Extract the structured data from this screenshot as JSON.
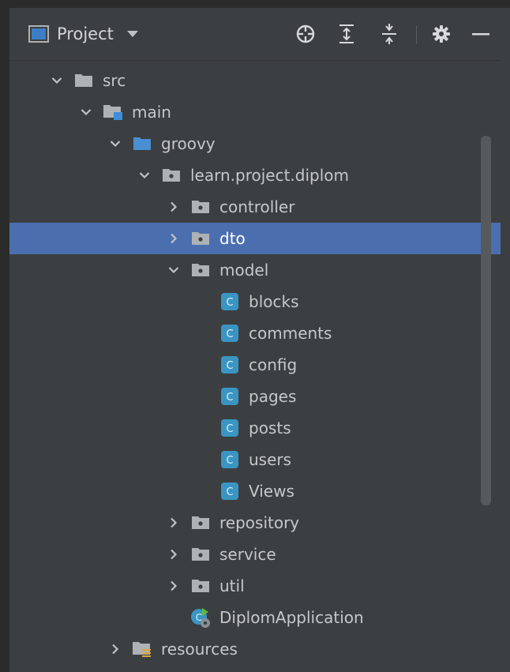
{
  "toolbar": {
    "title": "Project",
    "icons": [
      "project-window-icon",
      "chevron-down-icon",
      "locate-icon",
      "expand-all-icon",
      "collapse-all-icon",
      "gear-icon",
      "minimize-icon"
    ]
  },
  "tree": {
    "items": [
      {
        "label": "src",
        "depth": 0,
        "expanded": true,
        "kind": "folder-plain"
      },
      {
        "label": "main",
        "depth": 1,
        "expanded": true,
        "kind": "folder-module"
      },
      {
        "label": "groovy",
        "depth": 2,
        "expanded": true,
        "kind": "folder-source"
      },
      {
        "label": "learn.project.diplom",
        "depth": 3,
        "expanded": true,
        "kind": "package"
      },
      {
        "label": "controller",
        "depth": 4,
        "expanded": false,
        "kind": "package"
      },
      {
        "label": "dto",
        "depth": 4,
        "expanded": false,
        "kind": "package",
        "selected": true
      },
      {
        "label": "model",
        "depth": 4,
        "expanded": true,
        "kind": "package"
      },
      {
        "label": "blocks",
        "depth": 5,
        "kind": "class",
        "glyph": "C"
      },
      {
        "label": "comments",
        "depth": 5,
        "kind": "class",
        "glyph": "C"
      },
      {
        "label": "config",
        "depth": 5,
        "kind": "class",
        "glyph": "C"
      },
      {
        "label": "pages",
        "depth": 5,
        "kind": "class",
        "glyph": "C"
      },
      {
        "label": "posts",
        "depth": 5,
        "kind": "class",
        "glyph": "C"
      },
      {
        "label": "users",
        "depth": 5,
        "kind": "class",
        "glyph": "C"
      },
      {
        "label": "Views",
        "depth": 5,
        "kind": "class",
        "glyph": "C"
      },
      {
        "label": "repository",
        "depth": 4,
        "expanded": false,
        "kind": "package"
      },
      {
        "label": "service",
        "depth": 4,
        "expanded": false,
        "kind": "package"
      },
      {
        "label": "util",
        "depth": 4,
        "expanded": false,
        "kind": "package"
      },
      {
        "label": "DiplomApplication",
        "depth": 4,
        "kind": "app-class"
      },
      {
        "label": "resources",
        "depth": 2,
        "expanded": false,
        "kind": "folder-resources"
      }
    ]
  },
  "colors": {
    "panel_bg": "#3c3f41",
    "selection": "#4b6eaf",
    "text": "#c5c8ca",
    "folder": "#aeb2b5",
    "source_folder": "#4a8fd1",
    "class_badge": "#3a95c3"
  }
}
